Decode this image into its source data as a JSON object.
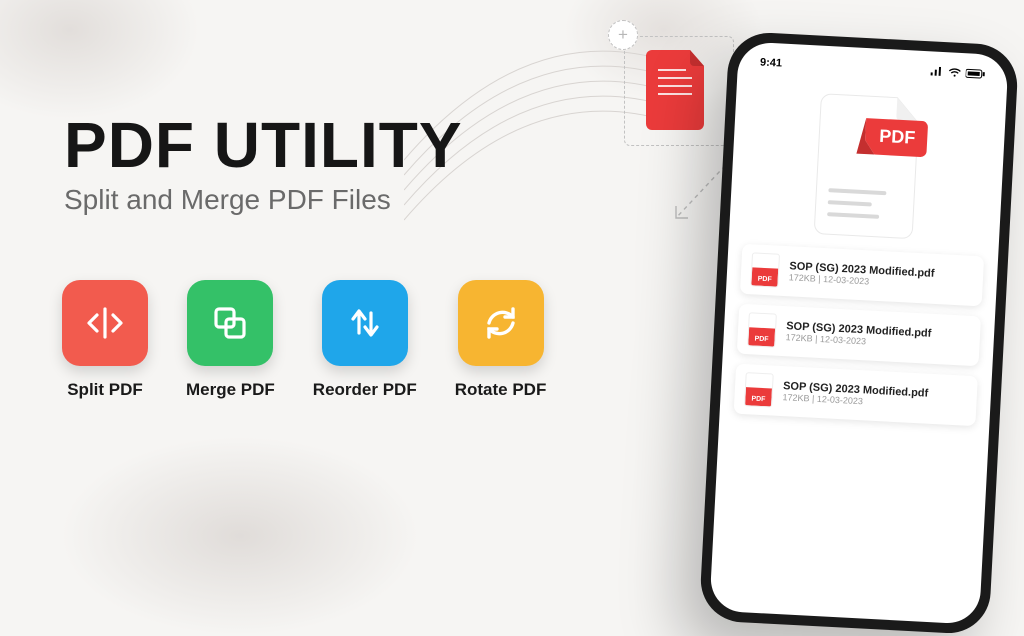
{
  "hero": {
    "title": "PDF UTILITY",
    "subtitle": "Split and Merge PDF Files"
  },
  "features": [
    {
      "label": "Split PDF",
      "color": "#f25b4e",
      "icon": "split"
    },
    {
      "label": "Merge PDF",
      "color": "#34c168",
      "icon": "merge"
    },
    {
      "label": "Reorder PDF",
      "color": "#1fa6ea",
      "icon": "reorder"
    },
    {
      "label": "Rotate PDF",
      "color": "#f7b531",
      "icon": "rotate"
    }
  ],
  "phone": {
    "status_time": "9:41",
    "pdf_badge": "PDF",
    "files": [
      {
        "name": "SOP (SG) 2023 Modified.pdf",
        "size": "172KB",
        "date": "12-03-2023"
      },
      {
        "name": "SOP (SG) 2023 Modified.pdf",
        "size": "172KB",
        "date": "12-03-2023"
      },
      {
        "name": "SOP (SG) 2023 Modified.pdf",
        "size": "172KB",
        "date": "12-03-2023"
      }
    ]
  },
  "floating": {
    "plus": "+"
  }
}
